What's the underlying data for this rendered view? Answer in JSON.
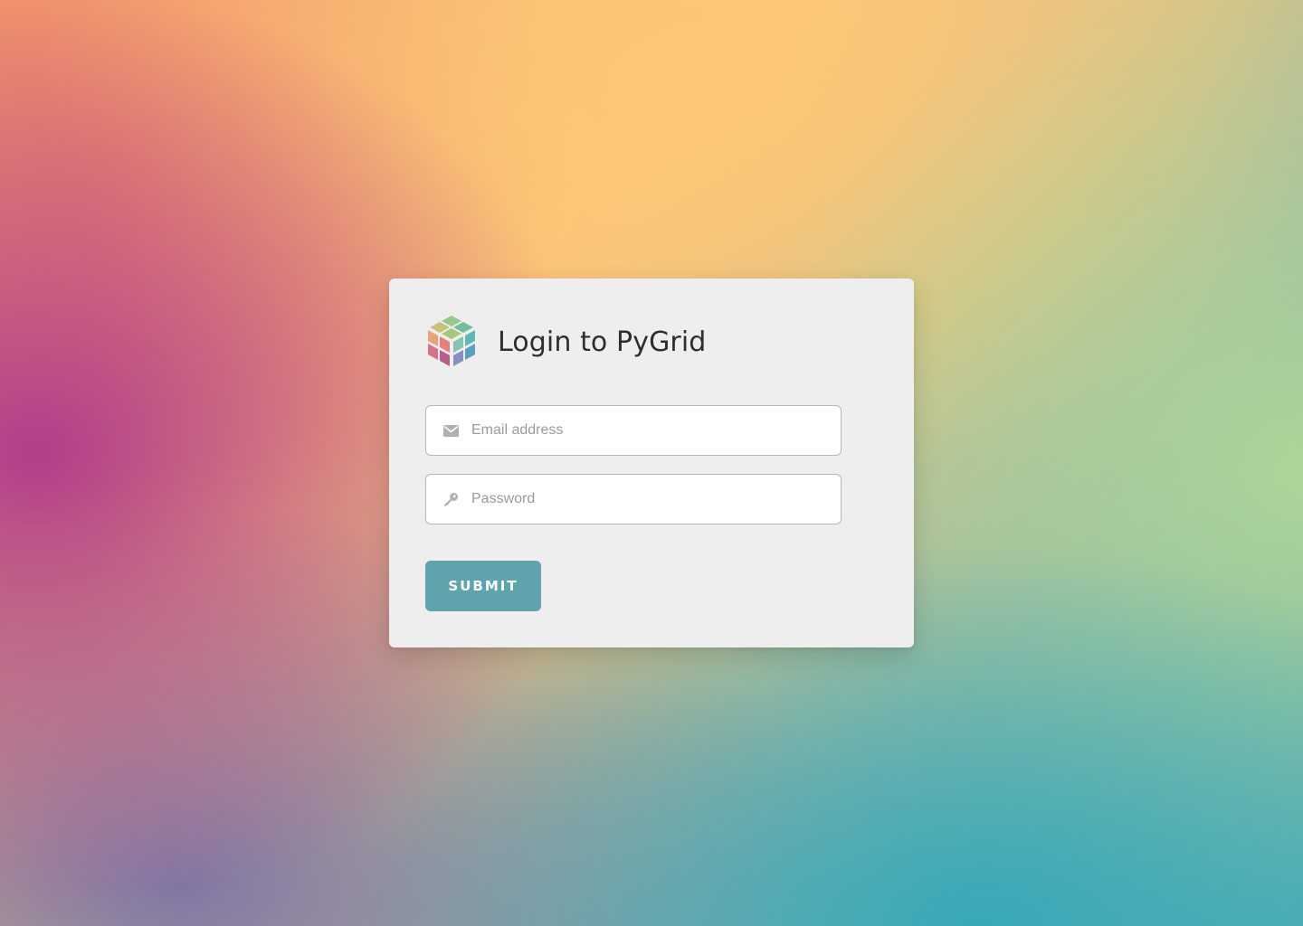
{
  "login": {
    "title": "Login to PyGrid",
    "email": {
      "placeholder": "Email address",
      "value": "",
      "icon": "envelope-icon"
    },
    "password": {
      "placeholder": "Password",
      "value": "",
      "icon": "key-icon"
    },
    "submit_label": "SUBMIT",
    "logo_icon": "pygrid-cube-logo"
  },
  "colors": {
    "card_background": "#eeeeee",
    "button_accent": "#5fa4ad",
    "title_text": "#2e2e2e",
    "icon_gray": "#b0b0b0"
  }
}
